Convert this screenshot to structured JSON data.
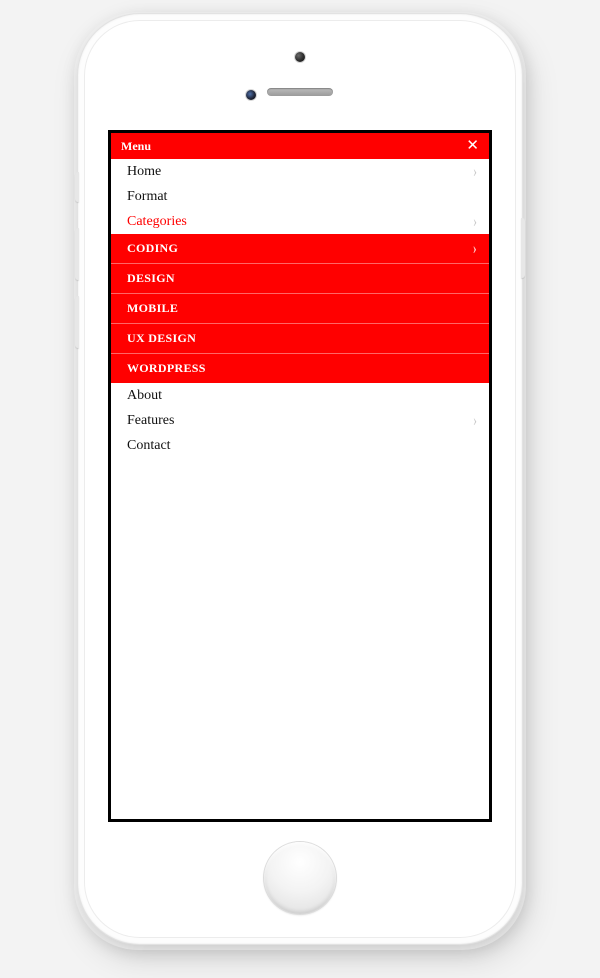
{
  "header": {
    "title": "Menu"
  },
  "menu": {
    "items": [
      {
        "label": "Home",
        "has_chevron": true,
        "active": false
      },
      {
        "label": "Format",
        "has_chevron": false,
        "active": false
      },
      {
        "label": "Categories",
        "has_chevron": true,
        "active": true
      },
      {
        "label": "About",
        "has_chevron": false,
        "active": false
      },
      {
        "label": "Features",
        "has_chevron": true,
        "active": false
      },
      {
        "label": "Contact",
        "has_chevron": false,
        "active": false
      }
    ]
  },
  "submenu": {
    "items": [
      {
        "label": "CODING",
        "has_chevron": true
      },
      {
        "label": "DESIGN",
        "has_chevron": false
      },
      {
        "label": "MOBILE",
        "has_chevron": false
      },
      {
        "label": "UX DESIGN",
        "has_chevron": false
      },
      {
        "label": "WORDPRESS",
        "has_chevron": false
      }
    ]
  },
  "colors": {
    "accent": "#ff0000"
  }
}
